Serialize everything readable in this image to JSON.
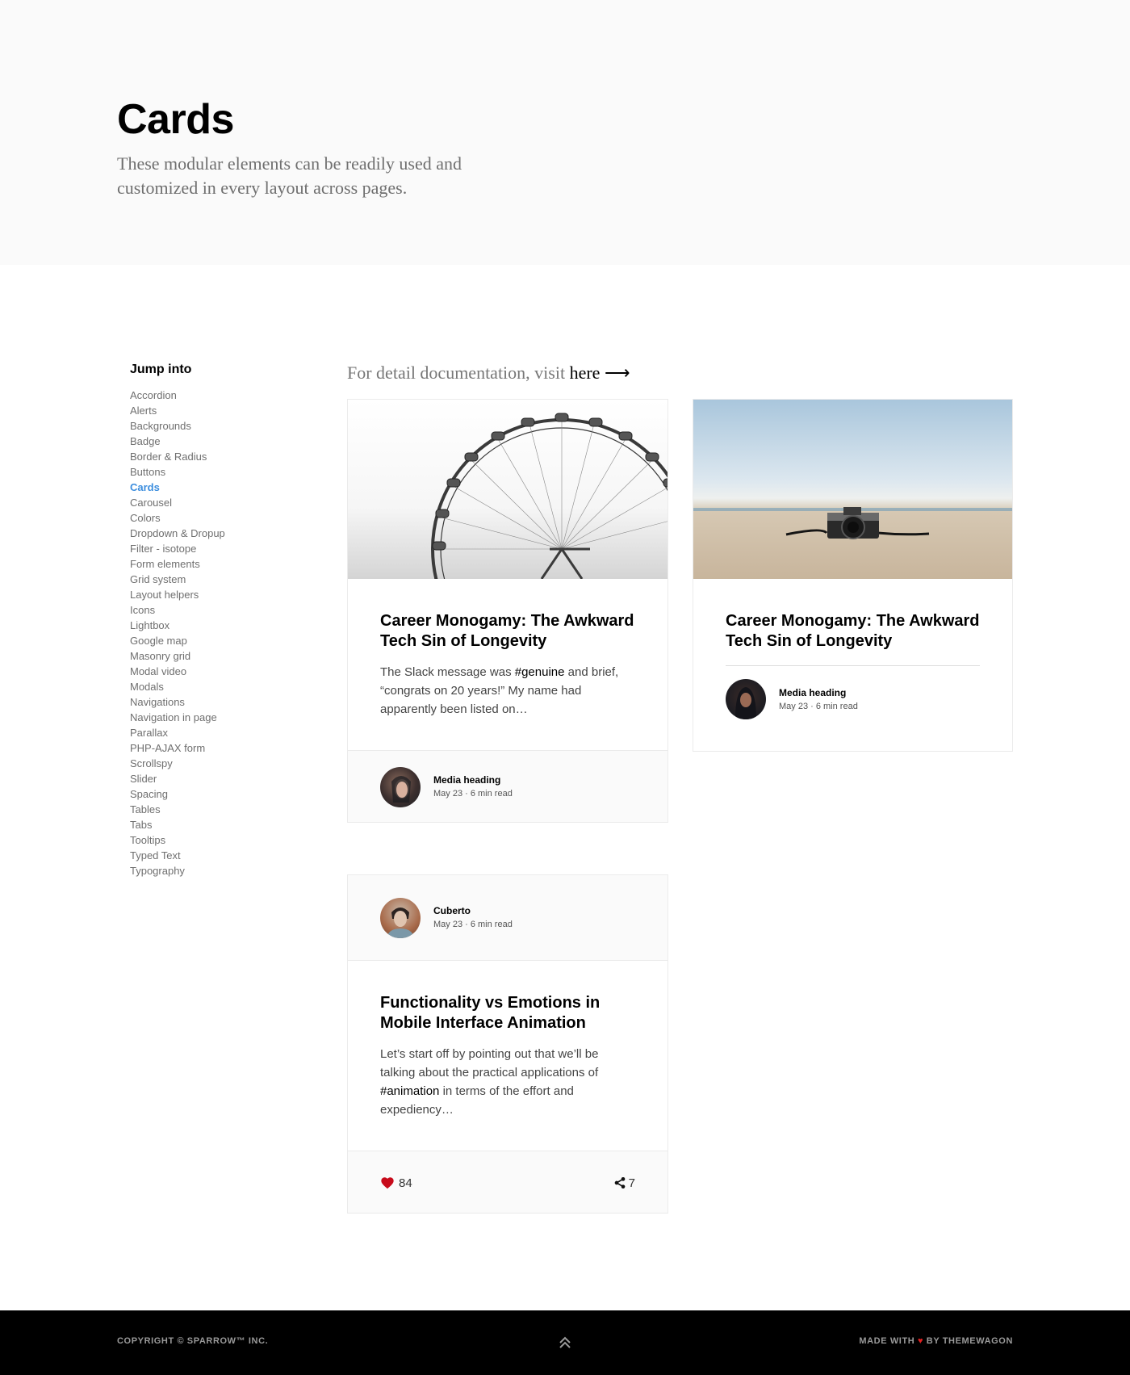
{
  "hero": {
    "title": "Cards",
    "subtitle": "These modular elements can be readily used and customized in every layout across pages."
  },
  "sidebar": {
    "title": "Jump into",
    "items": [
      "Accordion",
      "Alerts",
      "Backgrounds",
      "Badge",
      "Border & Radius",
      "Buttons",
      "Cards",
      "Carousel",
      "Colors",
      "Dropdown & Dropup",
      "Filter - isotope",
      "Form elements",
      "Grid system",
      "Layout helpers",
      "Icons",
      "Lightbox",
      "Google map",
      "Masonry grid",
      "Modal video",
      "Modals",
      "Navigations",
      "Navigation in page",
      "Parallax",
      "PHP-AJAX form",
      "Scrollspy",
      "Slider",
      "Spacing",
      "Tables",
      "Tabs",
      "Tooltips",
      "Typed Text",
      "Typography"
    ],
    "active": "Cards"
  },
  "doc": {
    "prefix": "For detail documentation, visit",
    "link_text": "here",
    "arrow": "⟶"
  },
  "card1": {
    "image_icon": "ferris-wheel-image",
    "title": "Career Monogamy: The Awkward Tech Sin of Longevity",
    "text_before": "The Slack message was",
    "tag": "#genuine",
    "text_after": "and brief, “congrats on 20 years!” My name had apparently been listed on…",
    "media_heading": "Media heading",
    "media_meta": "May 23 · 6 min read"
  },
  "card2": {
    "image_icon": "camera-on-beach-image",
    "title": "Career Monogamy: The Awkward Tech Sin of Longevity",
    "media_heading": "Media heading",
    "media_meta": "May 23 · 6 min read"
  },
  "card3": {
    "author": "Cuberto",
    "meta": "May 23 · 6 min read",
    "title": "Functionality vs Emotions in Mobile Interface Animation",
    "text_before": "Let’s start off by pointing out that we’ll be talking about the practical applications of",
    "tag": "#animation",
    "text_after": "in terms of the effort and expediency…",
    "likes": "84",
    "shares": "7"
  },
  "footer": {
    "copyright": "COPYRIGHT © SPARROW™ INC.",
    "made_prefix": "MADE WITH",
    "heart": "♥",
    "made_suffix": "BY THEMEWAGON"
  },
  "colors": {
    "accent": "#3d8ede",
    "like": "#c70a1a",
    "hero_bg": "#fafafa",
    "footer_bg": "#000000"
  }
}
